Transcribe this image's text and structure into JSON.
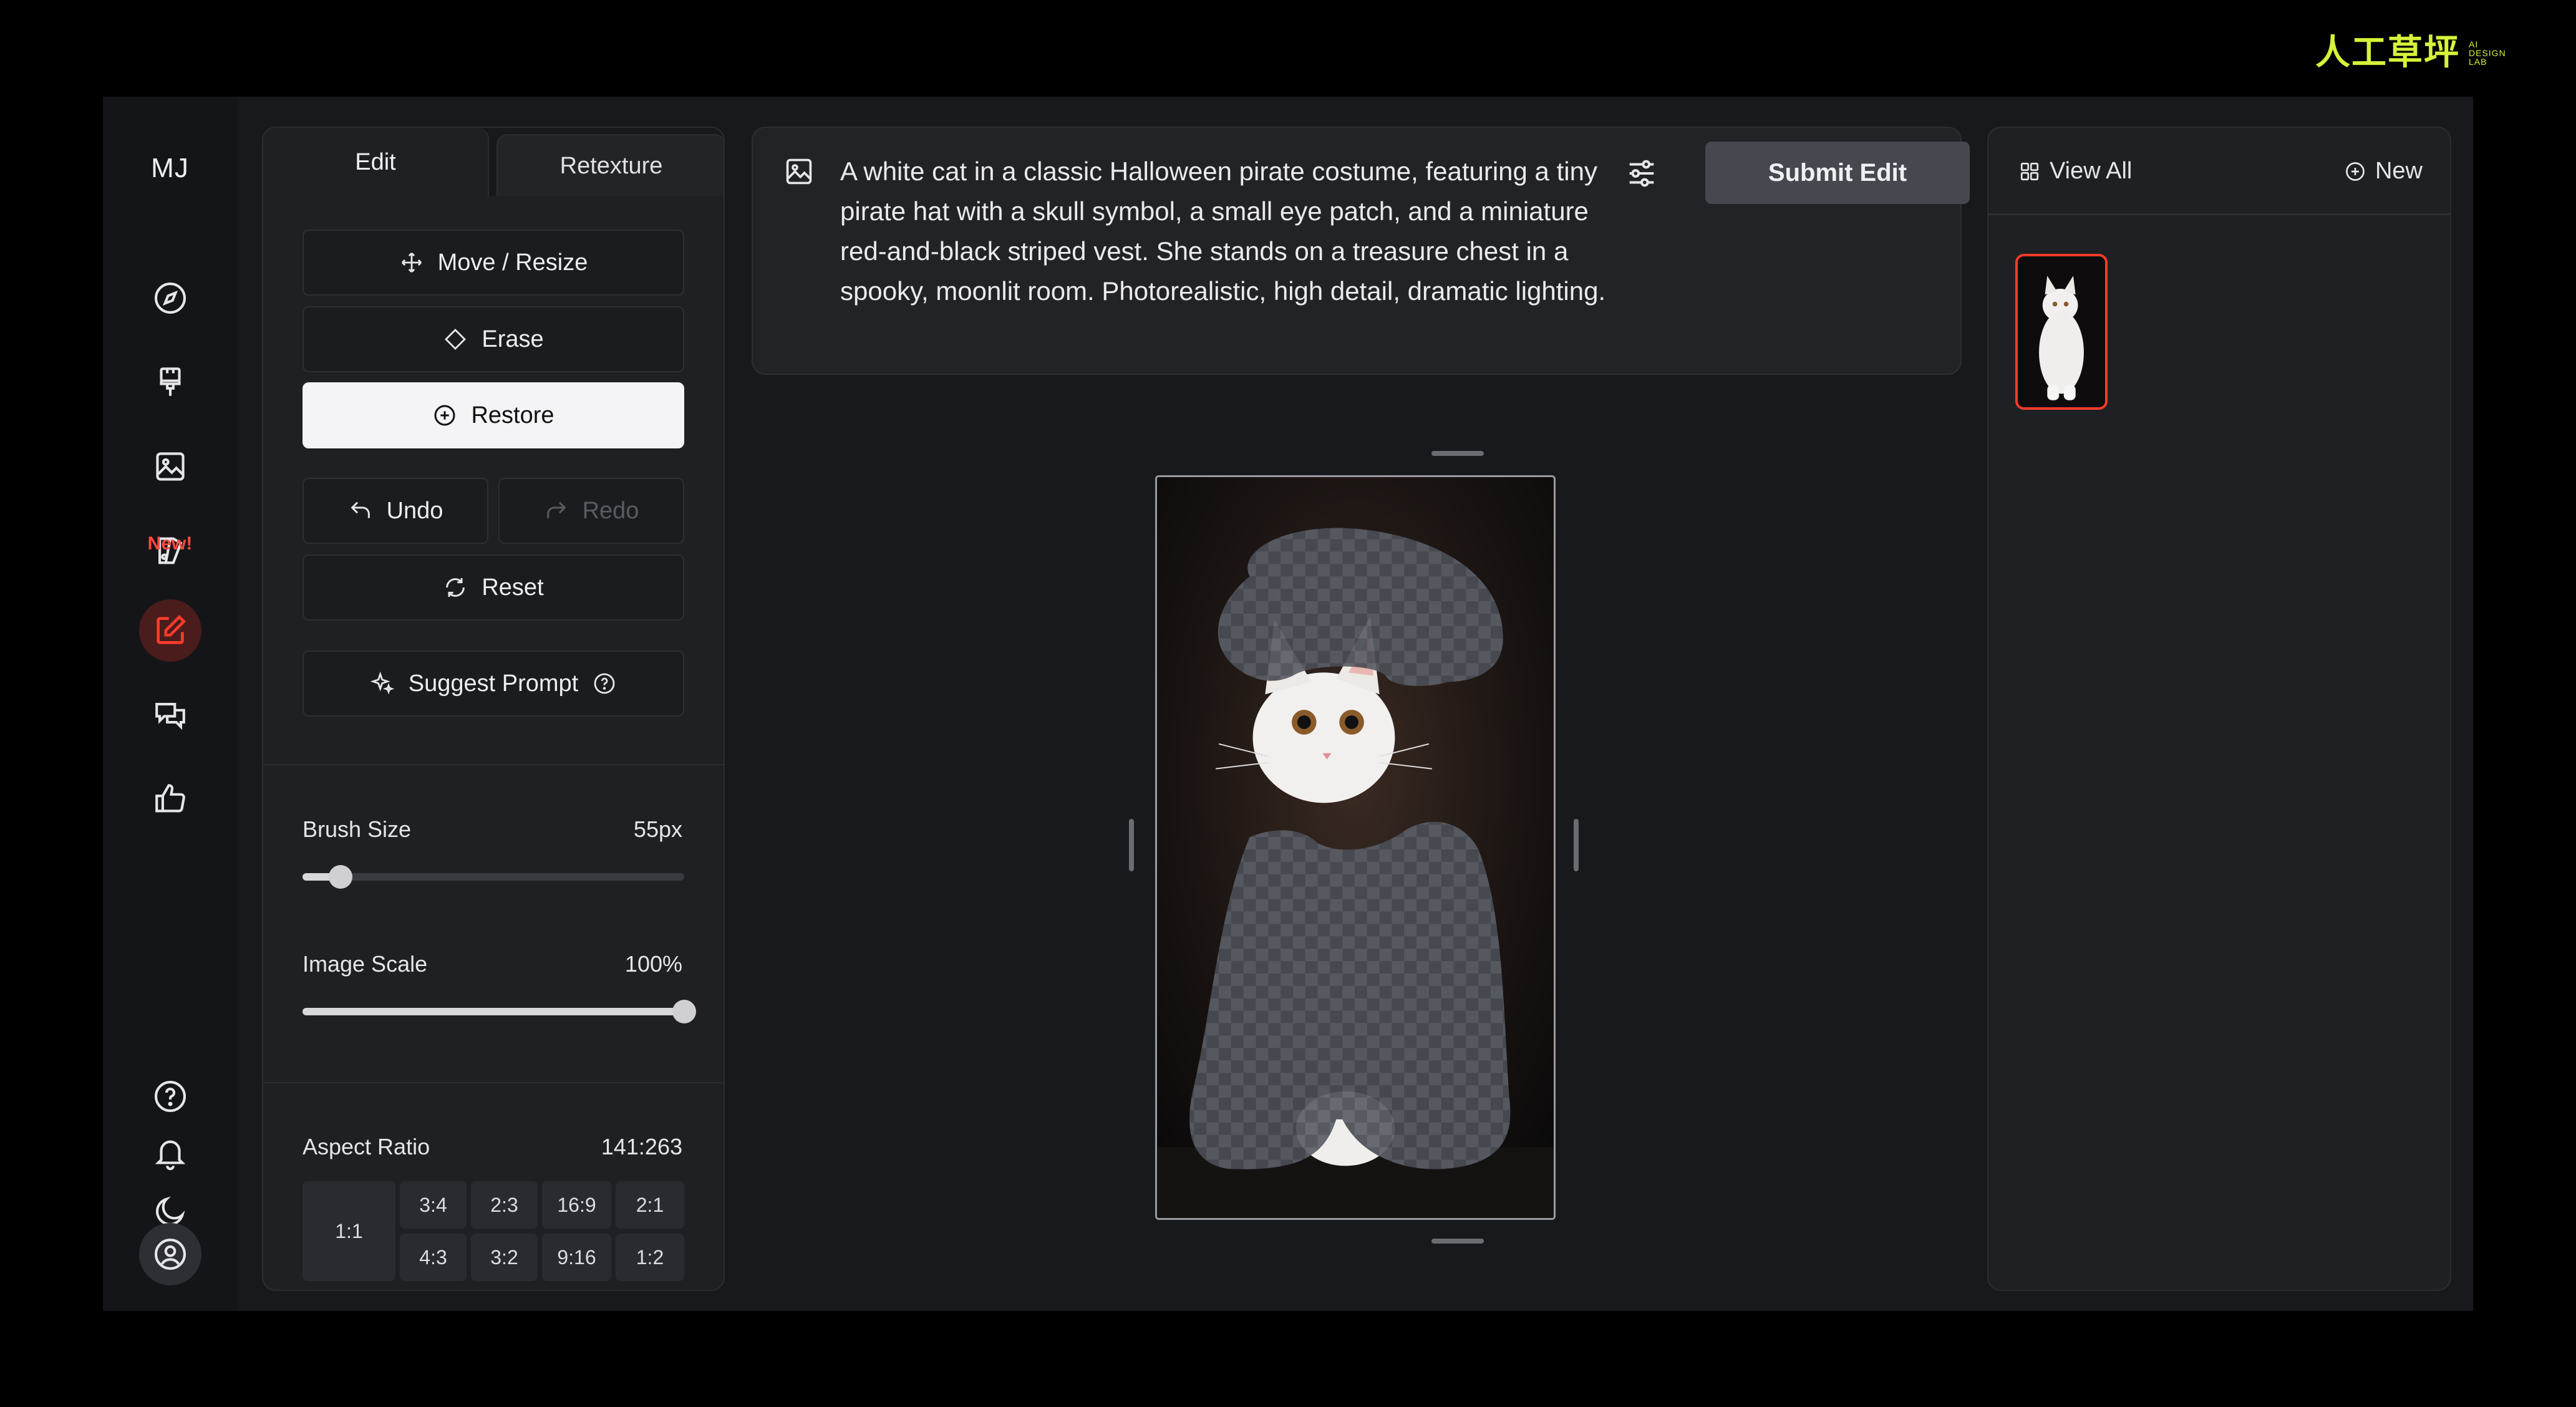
{
  "brand": {
    "name_cn": "人工草坪",
    "sub_lines": [
      "AI",
      "DESIGN",
      "LAB"
    ]
  },
  "rail": {
    "logo": "MJ",
    "new_badge": "New!",
    "icons": [
      "explore-icon",
      "brush-icon",
      "image-icon",
      "moodboard-icon",
      "edit-icon",
      "chat-icon",
      "like-icon",
      "help-icon",
      "bell-icon",
      "moon-icon",
      "account-icon"
    ]
  },
  "tools": {
    "tabs": [
      {
        "label": "Edit"
      },
      {
        "label": "Retexture"
      }
    ],
    "move_resize": "Move / Resize",
    "erase": "Erase",
    "restore": "Restore",
    "undo": "Undo",
    "redo": "Redo",
    "reset": "Reset",
    "suggest_prompt": "Suggest Prompt",
    "brush_size": {
      "label": "Brush Size",
      "value": "55px",
      "level": 0.1
    },
    "image_scale": {
      "label": "Image Scale",
      "value": "100%",
      "level": 1.0
    },
    "aspect_ratio": {
      "label": "Aspect Ratio",
      "value": "141:263",
      "options": [
        "1:1",
        "3:4",
        "2:3",
        "16:9",
        "2:1",
        "4:3",
        "3:2",
        "9:16",
        "1:2"
      ]
    }
  },
  "prompt": {
    "text": "A white cat in a classic Halloween pirate costume, featuring a tiny pirate hat with a skull symbol, a small eye patch, and a miniature red-and-black striped vest. She stands on a treasure chest in a spooky, moonlit room. Photorealistic, high detail, dramatic lighting.",
    "submit_label": "Submit Edit"
  },
  "gallery": {
    "view_all": "View All",
    "new": "New"
  },
  "colors": {
    "accent": "#ff3b2b",
    "brand": "#d7f23a",
    "active_rail": "#4a1c1c"
  }
}
